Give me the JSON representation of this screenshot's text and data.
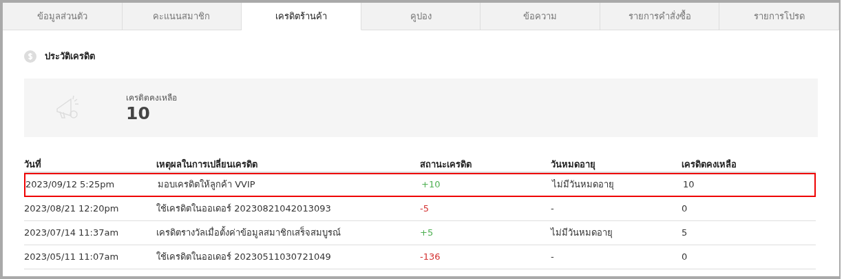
{
  "tabs": [
    {
      "label": "ข้อมูลส่วนตัว",
      "selected": false
    },
    {
      "label": "คะแนนสมาชิก",
      "selected": false
    },
    {
      "label": "เครดิตร้านค้า",
      "selected": true
    },
    {
      "label": "คูปอง",
      "selected": false
    },
    {
      "label": "ข้อความ",
      "selected": false
    },
    {
      "label": "รายการคำสั่งซื้อ",
      "selected": false
    },
    {
      "label": "รายการโปรด",
      "selected": false
    }
  ],
  "section_title": "ประวัติเครดิต",
  "summary": {
    "label": "เครดิตคงเหลือ",
    "value": "10"
  },
  "table": {
    "columns": [
      "วันที่",
      "เหตุผลในการเปลี่ยนเครดิต",
      "สถานะเครดิต",
      "วันหมดอายุ",
      "เครดิตคงเหลือ"
    ],
    "rows": [
      {
        "date": "2023/09/12 5:25pm",
        "reason": "มอบเครดิตให้ลูกค้า VVIP",
        "change": "+10",
        "kind": "gain",
        "expiry": "ไม่มีวันหมดอายุ",
        "balance": "10",
        "highlighted": true
      },
      {
        "date": "2023/08/21 12:20pm",
        "reason": "ใช้เครดิตในออเดอร์ 20230821042013093",
        "change": "-5",
        "kind": "loss",
        "expiry": "-",
        "balance": "0",
        "highlighted": false
      },
      {
        "date": "2023/07/14 11:37am",
        "reason": "เครดิตรางวัลเมื่อตั้งค่าข้อมูลสมาชิกเสร็จสมบูรณ์",
        "change": "+5",
        "kind": "gain",
        "expiry": "ไม่มีวันหมดอายุ",
        "balance": "5",
        "highlighted": false
      },
      {
        "date": "2023/05/11 11:07am",
        "reason": "ใช้เครดิตในออเดอร์ 20230511030721049",
        "change": "-136",
        "kind": "loss",
        "expiry": "-",
        "balance": "0",
        "highlighted": false
      }
    ]
  }
}
